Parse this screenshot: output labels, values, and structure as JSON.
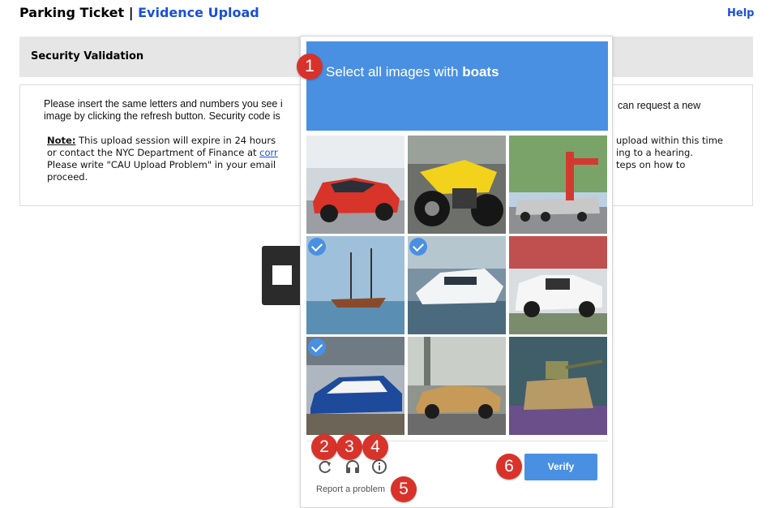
{
  "header": {
    "title": "Parking Ticket",
    "separator": "|",
    "subtitle": "Evidence Upload",
    "help_label": "Help"
  },
  "security": {
    "section_title": "Security Validation",
    "instruction_left": "Please insert the same letters and numbers you see i",
    "instruction_left_2": "image by clicking the refresh button. Security code is",
    "instruction_right": "can request a new",
    "note_label": "Note:",
    "note_line1": "This upload session will expire in 24 hours",
    "note_line2_pre": "or contact the NYC Department of Finance at",
    "note_link": "corr",
    "note_line3": "Please write \"CAU Upload Problem\" in your email",
    "note_line4": "proceed.",
    "note_right_1": "upload within this time",
    "note_right_2": "ing to a hearing.",
    "note_right_3": "teps on how to"
  },
  "recaptcha": {
    "prompt_prefix": "Select all images with",
    "prompt_target": "boats",
    "tiles": [
      {
        "subject": "red car",
        "selected": false
      },
      {
        "subject": "yellow motorcycle",
        "selected": false
      },
      {
        "subject": "crane truck",
        "selected": false
      },
      {
        "subject": "sailing boat",
        "selected": true
      },
      {
        "subject": "white motor yacht",
        "selected": true
      },
      {
        "subject": "white pickup truck",
        "selected": false
      },
      {
        "subject": "hovercraft boat",
        "selected": true
      },
      {
        "subject": "vintage car",
        "selected": false
      },
      {
        "subject": "tank model",
        "selected": false
      }
    ],
    "report_label": "Report a problem",
    "verify_label": "Verify",
    "icons": [
      "refresh-icon",
      "headphones-icon",
      "info-icon"
    ]
  },
  "markers": [
    "1",
    "2",
    "3",
    "4",
    "5",
    "6"
  ],
  "colors": {
    "accent_blue": "#4a90e2",
    "link_blue": "#1a4fd6",
    "marker_red": "#d8332b",
    "section_gray": "#e6e6e6"
  }
}
